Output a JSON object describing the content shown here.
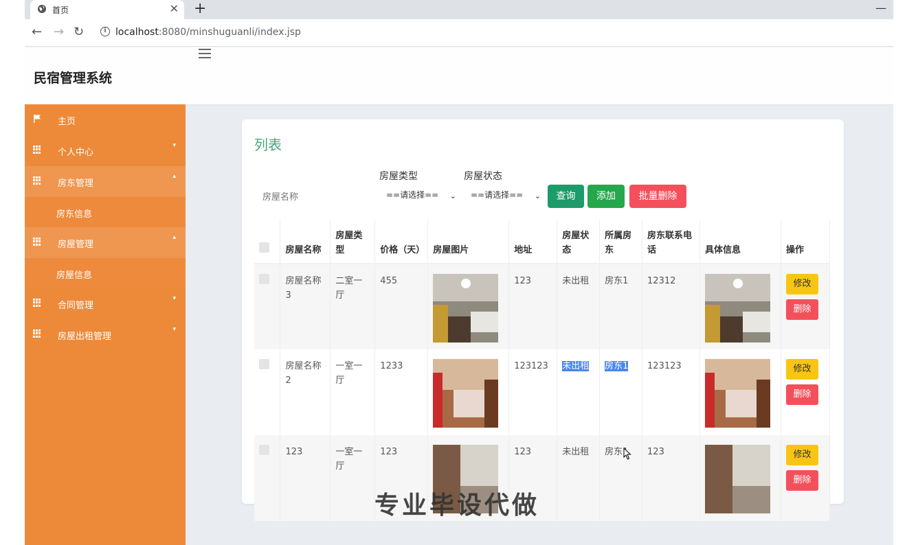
{
  "browser": {
    "tab_title": "首页",
    "tab_close": "✕",
    "new_tab": "+",
    "minimize": "—",
    "url_host": "localhost",
    "url_rest": ":8080/minshuguanli/index.jsp"
  },
  "app": {
    "brand": "民宿管理系统"
  },
  "sidebar": {
    "items": [
      {
        "label": "主页",
        "icon": "flag-icon"
      },
      {
        "label": "个人中心",
        "icon": "grid-icon"
      },
      {
        "label": "房东管理",
        "icon": "grid-icon"
      },
      {
        "label": "房东信息",
        "sub": true
      },
      {
        "label": "房屋管理",
        "icon": "grid-icon"
      },
      {
        "label": "房屋信息",
        "sub": true
      },
      {
        "label": "合同管理",
        "icon": "grid-icon"
      },
      {
        "label": "房屋出租管理",
        "icon": "grid-icon"
      }
    ]
  },
  "panel": {
    "title": "列表",
    "search_placeholder": "房屋名称",
    "type_label": "房屋类型",
    "status_label": "房屋状态",
    "type_select": "==请选择==",
    "status_select": "==请选择==",
    "query_button": "查询",
    "add_button": "添加",
    "batch_delete_button": "批量删除"
  },
  "table": {
    "headers": [
      "房屋名称",
      "房屋类型",
      "价格（天）",
      "房屋图片",
      "地址",
      "房屋状态",
      "所属房东",
      "房东联系电话",
      "具体信息",
      "操作"
    ],
    "rows": [
      {
        "name": "房屋名称3",
        "type": "二室一厅",
        "price": "455",
        "address": "123",
        "status": "未出租",
        "owner": "房东1",
        "phone": "12312"
      },
      {
        "name": "房屋名称2",
        "type": "一室一厅",
        "price": "1233",
        "address": "123123",
        "status": "未出租",
        "owner": "房东1",
        "phone": "123123"
      },
      {
        "name": "123",
        "type": "一室一厅",
        "price": "123",
        "address": "123",
        "status": "未出租",
        "owner": "房东1",
        "phone": "123"
      }
    ],
    "edit_label": "修改",
    "delete_label": "删除"
  },
  "overlay": {
    "watermark": "专业毕设代做"
  },
  "colors": {
    "sidebar": "#ec8a3a",
    "title_green": "#4aa37a",
    "query": "#1e9b6b",
    "add": "#27a74d",
    "danger": "#f4505b",
    "warning": "#f9c513"
  }
}
